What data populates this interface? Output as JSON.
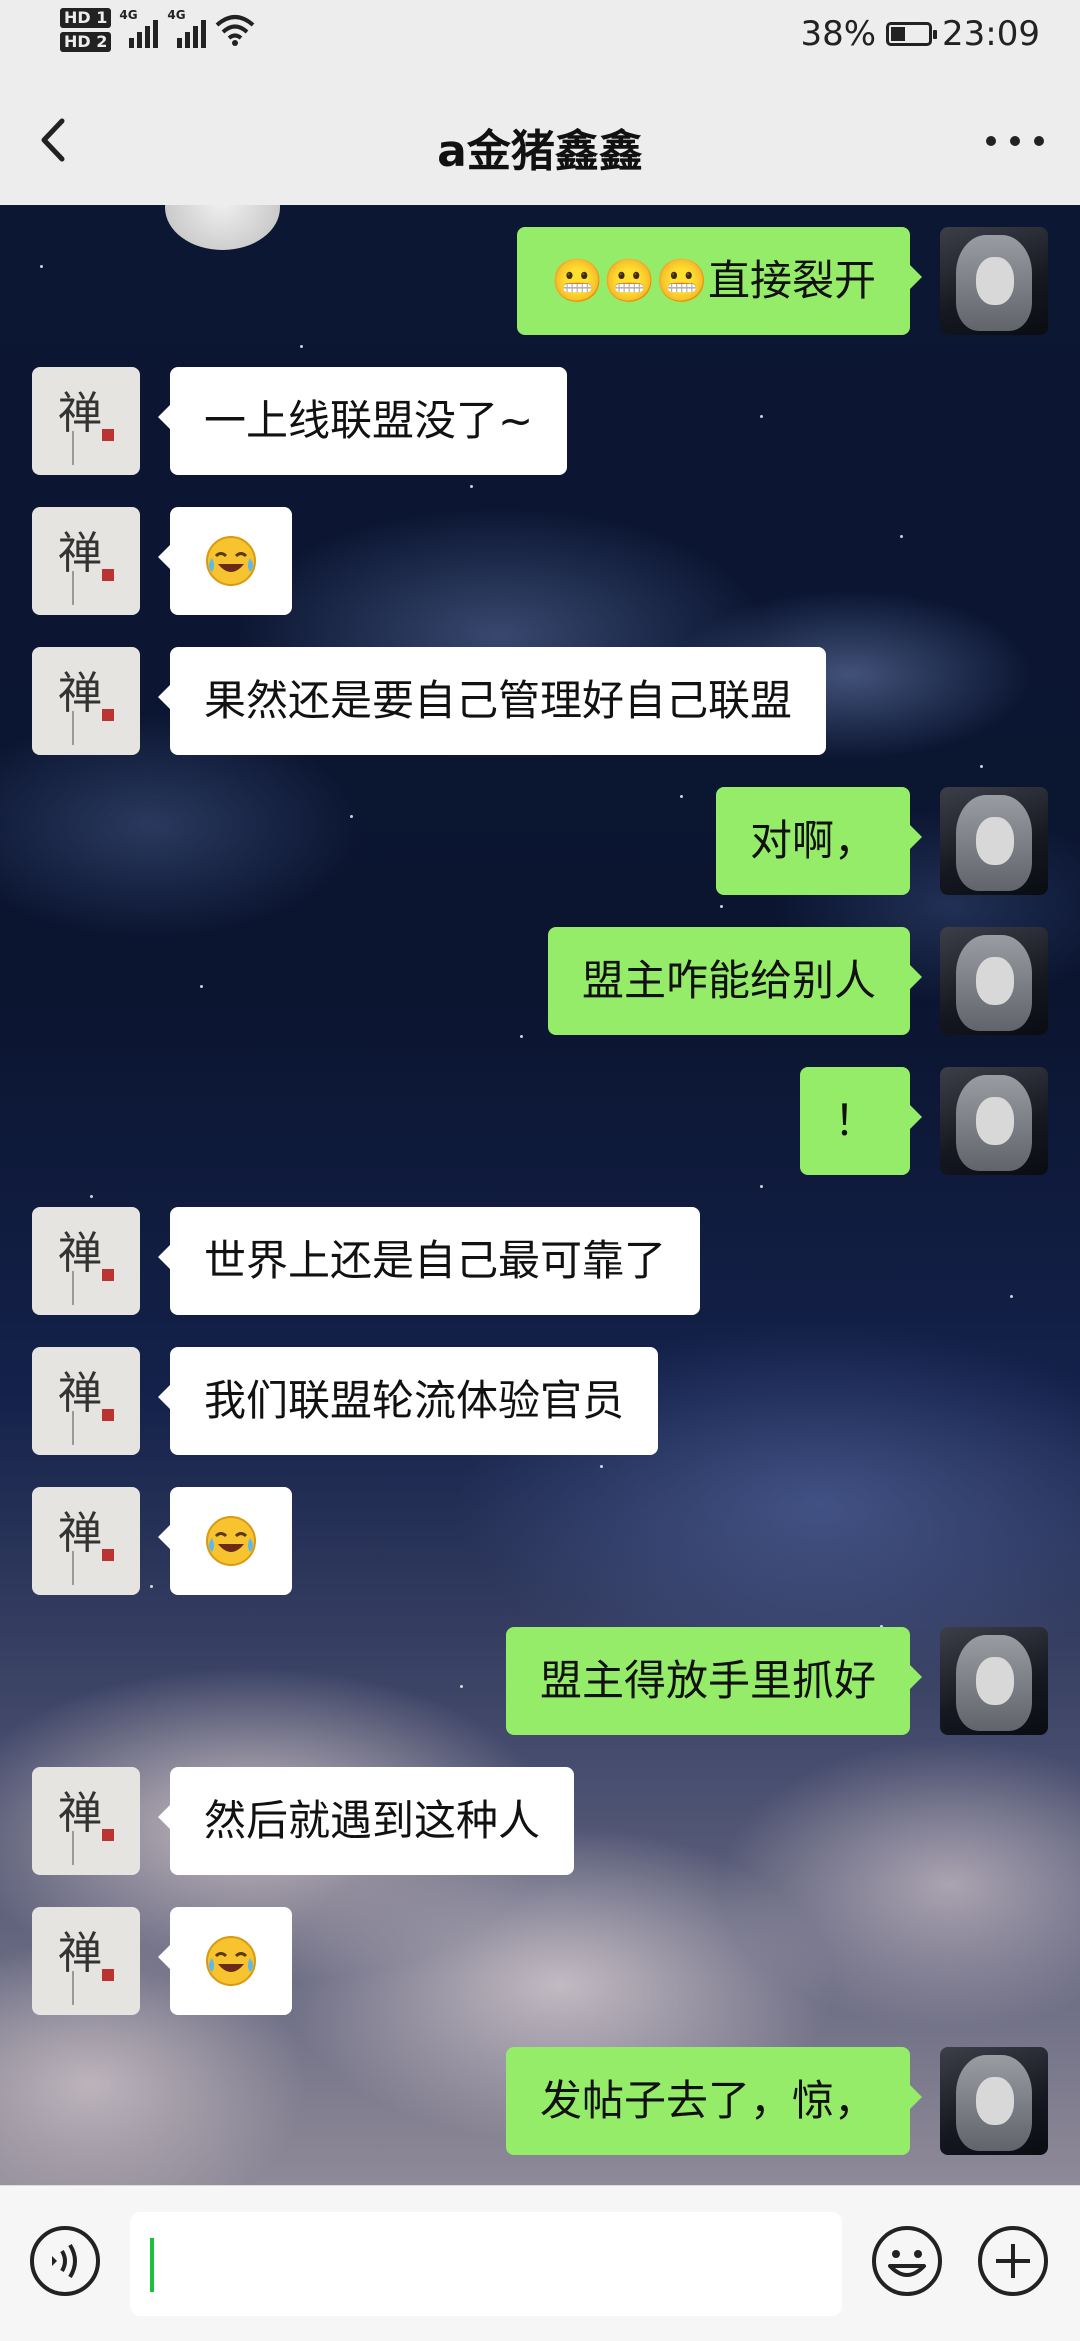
{
  "status": {
    "sim1_badge": "HD 1",
    "sim2_badge": "HD 2",
    "net1": "4G",
    "net2": "4G",
    "battery": "38%",
    "battery_level": 0.38,
    "time": "23:09"
  },
  "header": {
    "title": "a金猪鑫鑫",
    "back_icon": "chevron-left-icon",
    "more_icon": "more-dots-icon"
  },
  "messages": [
    {
      "sender": "self",
      "text": "😬😬😬直接裂开"
    },
    {
      "sender": "other",
      "text": "一上线联盟没了~"
    },
    {
      "sender": "other",
      "text": "",
      "emoji": "crying-laughing"
    },
    {
      "sender": "other",
      "text": "果然还是要自己管理好自己联盟"
    },
    {
      "sender": "self",
      "text": "对啊，"
    },
    {
      "sender": "self",
      "text": "盟主咋能给别人"
    },
    {
      "sender": "self",
      "text": "！"
    },
    {
      "sender": "other",
      "text": "世界上还是自己最可靠了"
    },
    {
      "sender": "other",
      "text": "我们联盟轮流体验官员"
    },
    {
      "sender": "other",
      "text": "",
      "emoji": "crying-laughing"
    },
    {
      "sender": "self",
      "text": "盟主得放手里抓好"
    },
    {
      "sender": "other",
      "text": "然后就遇到这种人"
    },
    {
      "sender": "other",
      "text": "",
      "emoji": "crying-laughing"
    },
    {
      "sender": "self",
      "text": "发帖子去了，惊，"
    }
  ],
  "other_avatar_char": "禅",
  "input": {
    "value": "",
    "voice_icon": "voice-icon",
    "emoji_icon": "emoji-icon",
    "plus_icon": "plus-icon"
  },
  "colors": {
    "self_bubble": "#95ec69",
    "other_bubble": "#ffffff",
    "bar_bg": "#ededed",
    "cursor": "#19c23a"
  }
}
